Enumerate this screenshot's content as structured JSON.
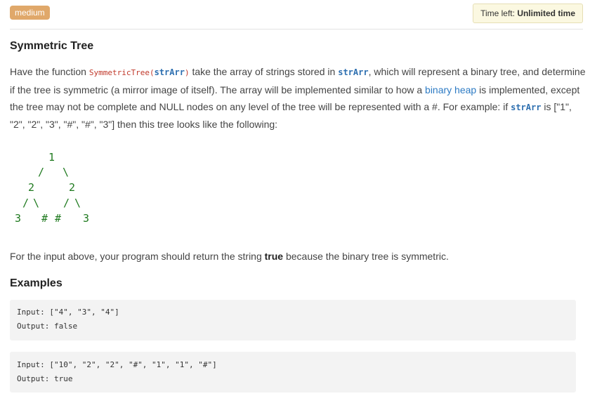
{
  "header": {
    "difficulty": "medium",
    "time_label": "Time left: ",
    "time_value": "Unlimited time"
  },
  "problem": {
    "title": "Symmetric Tree",
    "desc": {
      "p1": "Have the function ",
      "fn": "SymmetricTree(",
      "param": "strArr",
      "fn_close": ")",
      "p2": " take the array of strings stored in ",
      "p3": ", which will represent a binary tree, and determine if the tree is symmetric (a mirror image of itself). The array will be implemented similar to how a ",
      "link": "binary heap",
      "p4": " is implemented, except the tree may not be complete and NULL nodes on any level of the tree will be represented with a #. For example: if ",
      "p5": " is [\"1\", \"2\", \"2\", \"3\", \"#\", \"#\", \"3\"] then this tree looks like the following:"
    },
    "tree": {
      "n1": "1",
      "e1": "/",
      "e2": "\\",
      "n2a": "2",
      "n2b": "2",
      "e3": "/",
      "e4": "\\",
      "e5": "/",
      "e6": "\\",
      "n3a": "3",
      "n3b": "#",
      "n3c": "#",
      "n3d": "3"
    },
    "after": {
      "p1": "For the input above, your program should return the string ",
      "bold": "true",
      "p2": " because the binary tree is symmetric."
    },
    "examples_heading": "Examples",
    "examples": [
      {
        "input": "Input: [\"4\", \"3\", \"4\"]",
        "output": "Output: false"
      },
      {
        "input": "Input: [\"10\", \"2\", \"2\", \"#\", \"1\", \"1\", \"#\"]",
        "output": "Output: true"
      }
    ]
  },
  "colors": {
    "badge": "#e0a86a",
    "tree": "#1f7a1f",
    "link": "#2d7bc4",
    "function": "#c0392b",
    "param": "#2d6fb0"
  }
}
